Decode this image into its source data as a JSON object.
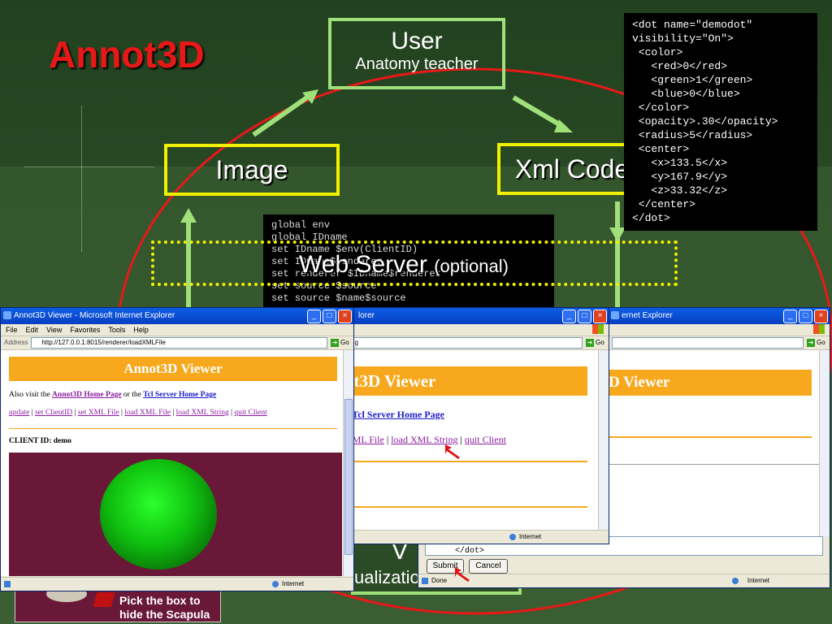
{
  "slide": {
    "title": "Annot3D",
    "user_title": "User",
    "user_subtitle": "Anatomy teacher",
    "image_label": "Image",
    "xml_label": "Xml Code",
    "web_server_label": "Web Server",
    "web_server_optional": "(optional)",
    "viz_fragment_1": "V",
    "viz_fragment_2": "ualizatio",
    "caption_line1": "Pick the box to",
    "caption_line2": "hide the Scapula"
  },
  "xml_code": {
    "lines": [
      "<dot name=\"demodot\"",
      "visibility=\"On\">",
      " <color>",
      "   <red>0</red>",
      "   <green>1</green>",
      "   <blue>0</blue>",
      " </color>",
      " <opacity>.30</opacity>",
      " <radius>5</radius>",
      " <center>",
      "   <x>133.5</x>",
      "   <y>167.9</y>",
      "   <z>33.32</z>",
      " </center>",
      "</dot>"
    ]
  },
  "tcl_code": {
    "lines": [
      "global env",
      "global IDname",
      "set IDname $env(ClientID)",
      "set IDname$renderer",
      "set renderer $IDname$renderer",
      "set source $source",
      "set source $name$source"
    ]
  },
  "win1": {
    "title": "Annot3D Viewer - Microsoft Internet Explorer",
    "menu": [
      "File",
      "Edit",
      "View",
      "Favorites",
      "Tools",
      "Help"
    ],
    "address_label": "Address",
    "address_url": "http://127.0.0.1:8015/renderer/loadXMLFile",
    "go": "Go",
    "banner": "Annot3D Viewer",
    "also_visit": "Also visit the",
    "link_home": "Annot3D Home Page",
    "or_the": "or the",
    "link_tcl": "Tcl Server Home Page",
    "actions": [
      "update",
      "set ClientID",
      "set XML File",
      "load XML File",
      "load XML String",
      "quit Client"
    ],
    "client_id_label": "CLIENT ID: demo",
    "status_right": "Internet"
  },
  "win2": {
    "title": "lorer",
    "address_partial": "ng",
    "go": "Go",
    "banner": "ot3D Viewer",
    "link_prefix": "e",
    "link_tcl": "Tcl Server Home Page",
    "actions": [
      "XML File",
      "load XML String",
      "quit Client"
    ],
    "status_right": "Internet"
  },
  "win3": {
    "title": "ernet Explorer",
    "go": "Go",
    "banner": "D Viewer",
    "textarea_tail": "</dot>",
    "submit": "Submit",
    "cancel": "Cancel",
    "status_left": "Done",
    "status_right": "Internet"
  },
  "colors": {
    "title_red": "#e81818",
    "flow_green": "#9fe07a",
    "box_yellow": "#f0f000",
    "banner_orange": "#f7a81d",
    "viewport_maroon": "#6a1838",
    "sphere_green": "#0fc00f"
  }
}
